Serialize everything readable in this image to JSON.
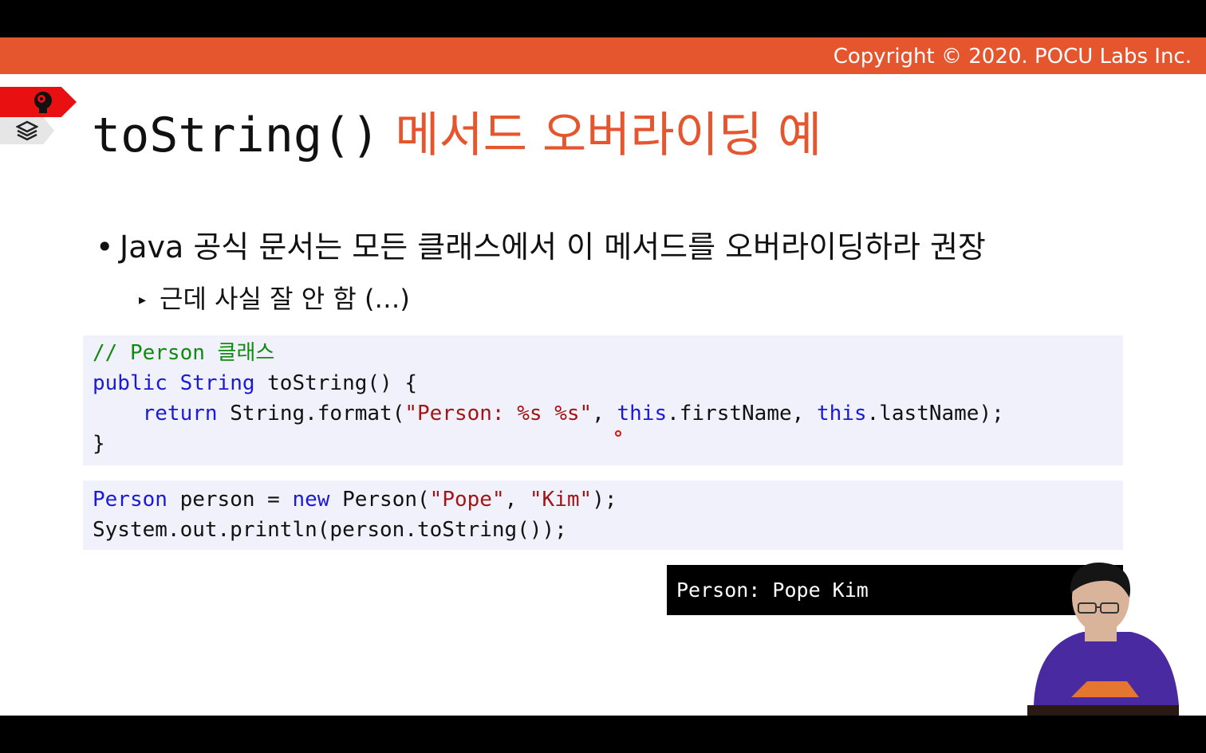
{
  "header": {
    "copyright": "Copyright © 2020. POCU Labs Inc."
  },
  "title": {
    "code_part": "toString()",
    "korean_part": "메서드 오버라이딩 예"
  },
  "bullets": {
    "level1": "Java 공식 문서는 모든 클래스에서 이 메서드를 오버라이딩하라 권장",
    "level2": "근데 사실 잘 안 함 (…)"
  },
  "code_block_1": {
    "comment": "// Person 클래스",
    "line2": {
      "kw1": "public",
      "kw2": "String",
      "rest": " toString() {"
    },
    "line3": {
      "indent": "    ",
      "kw": "return",
      "a": " String.format(",
      "str": "\"Person: %s %s\"",
      "b": ", ",
      "kw_this1": "this",
      "c": ".firstName, ",
      "kw_this2": "this",
      "d": ".lastName);"
    },
    "line4": "}"
  },
  "code_block_2": {
    "line1": {
      "type": "Person",
      "a": " person = ",
      "kw": "new",
      "b": " Person(",
      "str1": "\"Pope\"",
      "c": ", ",
      "str2": "\"Kim\"",
      "d": ");"
    },
    "line2": "System.out.println(person.toString());"
  },
  "output": {
    "text": "Person: Pope Kim"
  },
  "colors": {
    "accent": "#e5562f",
    "keyword": "#1a1ad6",
    "string": "#a21515",
    "comment": "#108a10",
    "code_bg": "#f1f1fb"
  },
  "icons": [
    "brain-icon",
    "stack-icon",
    "presenter-video"
  ]
}
